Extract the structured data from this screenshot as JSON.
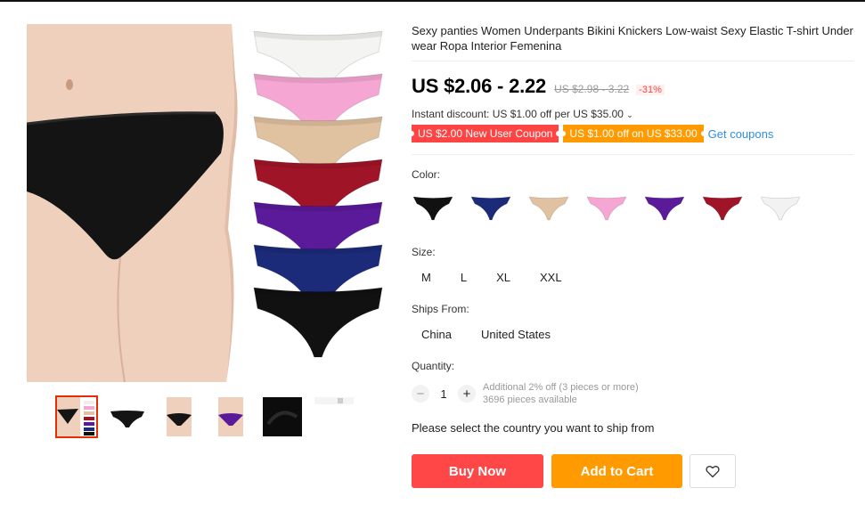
{
  "product": {
    "title": "Sexy panties Women Underpants Bikini Knickers Low-waist Sexy Elastic T-shirt Underwear Ropa Interior Femenina",
    "price": "US $2.06 - 2.22",
    "old_price": "US $2.98 - 3.22",
    "discount": "-31%"
  },
  "promo": {
    "instant_discount": "Instant discount: US $1.00 off per US $35.00",
    "coupon_new_user": "US $2.00 New User Coupon",
    "coupon_off": "US $1.00 off on US $33.00",
    "get_coupons": "Get coupons"
  },
  "color": {
    "label": "Color:",
    "swatches": [
      {
        "name": "black",
        "hex": "#111111"
      },
      {
        "name": "navy",
        "hex": "#1c2a7a"
      },
      {
        "name": "nude",
        "hex": "#e0c1a0"
      },
      {
        "name": "pink",
        "hex": "#f6a6d2"
      },
      {
        "name": "purple",
        "hex": "#5a1a9a"
      },
      {
        "name": "wine-red",
        "hex": "#a01428"
      },
      {
        "name": "white",
        "hex": "#f2f2f2"
      }
    ]
  },
  "size": {
    "label": "Size:",
    "options": [
      "M",
      "L",
      "XL",
      "XXL"
    ]
  },
  "ships_from": {
    "label": "Ships From:",
    "options": [
      "China",
      "United States"
    ]
  },
  "quantity": {
    "label": "Quantity:",
    "value": "1",
    "minus": "−",
    "plus": "+",
    "additional": "Additional 2% off (3 pieces or more)",
    "available": "3696 pieces available"
  },
  "ship_message": "Please select the country you want to ship from",
  "actions": {
    "buy_now": "Buy Now",
    "add_to_cart": "Add to Cart"
  },
  "colors": {
    "buy_now": "#ff4747",
    "add_to_cart": "#ff9b00",
    "link": "#2e8ce6"
  },
  "gallery": {
    "stack_colors": [
      "#f4f4f2",
      "#f6a6d2",
      "#e0c1a0",
      "#a01428",
      "#5a1a9a",
      "#1c2a7a",
      "#111111"
    ]
  }
}
